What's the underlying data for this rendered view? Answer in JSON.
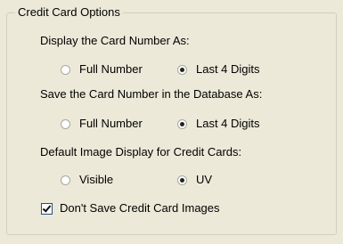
{
  "group": {
    "title": "Credit Card Options"
  },
  "sections": [
    {
      "label": "Display the Card Number As:",
      "options": [
        {
          "label": "Full Number",
          "checked": false
        },
        {
          "label": "Last 4 Digits",
          "checked": true
        }
      ]
    },
    {
      "label": "Save the Card Number in the Database As:",
      "options": [
        {
          "label": "Full Number",
          "checked": false
        },
        {
          "label": "Last 4 Digits",
          "checked": true
        }
      ]
    },
    {
      "label": "Default Image Display for Credit Cards:",
      "options": [
        {
          "label": "Visible",
          "checked": false
        },
        {
          "label": "UV",
          "checked": true
        }
      ]
    }
  ],
  "checkbox": {
    "label": "Don't Save Credit Card Images",
    "checked": true
  }
}
